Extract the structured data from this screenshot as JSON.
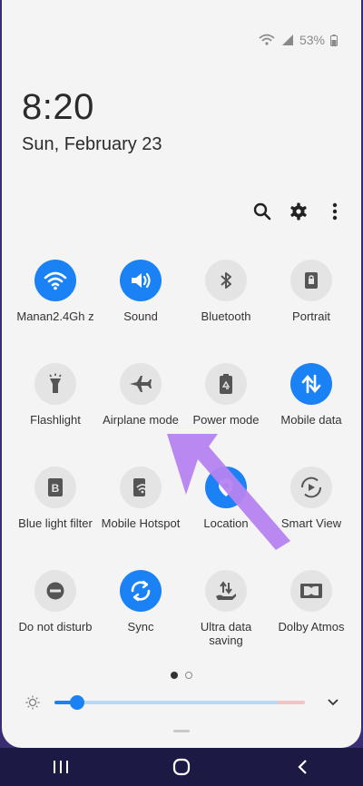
{
  "status": {
    "battery": "53%"
  },
  "clock": {
    "time": "8:20",
    "date": "Sun, February 23"
  },
  "toolbar": {
    "search_icon": "search-icon",
    "settings_icon": "gear-icon",
    "more_icon": "more-vertical-icon"
  },
  "tiles": [
    {
      "label": "Manan2.4Gh z",
      "icon": "wifi-icon",
      "on": true
    },
    {
      "label": "Sound",
      "icon": "speaker-icon",
      "on": true
    },
    {
      "label": "Bluetooth",
      "icon": "bluetooth-icon",
      "on": false
    },
    {
      "label": "Portrait",
      "icon": "rotation-lock-icon",
      "on": false
    },
    {
      "label": "Flashlight",
      "icon": "flashlight-icon",
      "on": false
    },
    {
      "label": "Airplane mode",
      "icon": "airplane-icon",
      "on": false
    },
    {
      "label": "Power mode",
      "icon": "battery-recycle-icon",
      "on": false
    },
    {
      "label": "Mobile data",
      "icon": "data-arrows-icon",
      "on": true
    },
    {
      "label": "Blue light filter",
      "icon": "blue-light-icon",
      "on": false
    },
    {
      "label": "Mobile Hotspot",
      "icon": "hotspot-icon",
      "on": false
    },
    {
      "label": "Location",
      "icon": "location-icon",
      "on": true
    },
    {
      "label": "Smart View",
      "icon": "smart-view-icon",
      "on": false
    },
    {
      "label": "Do not disturb",
      "icon": "minus-circle-icon",
      "on": false
    },
    {
      "label": "Sync",
      "icon": "sync-icon",
      "on": true
    },
    {
      "label": "Ultra data saving",
      "icon": "data-saving-icon",
      "on": false
    },
    {
      "label": "Dolby Atmos",
      "icon": "dolby-icon",
      "on": false
    }
  ],
  "pager": {
    "pages": 2,
    "current": 1
  },
  "brightness": {
    "level": 0.09
  },
  "colors": {
    "accent": "#1a82f5",
    "annotation_arrow": "#b583f0"
  }
}
